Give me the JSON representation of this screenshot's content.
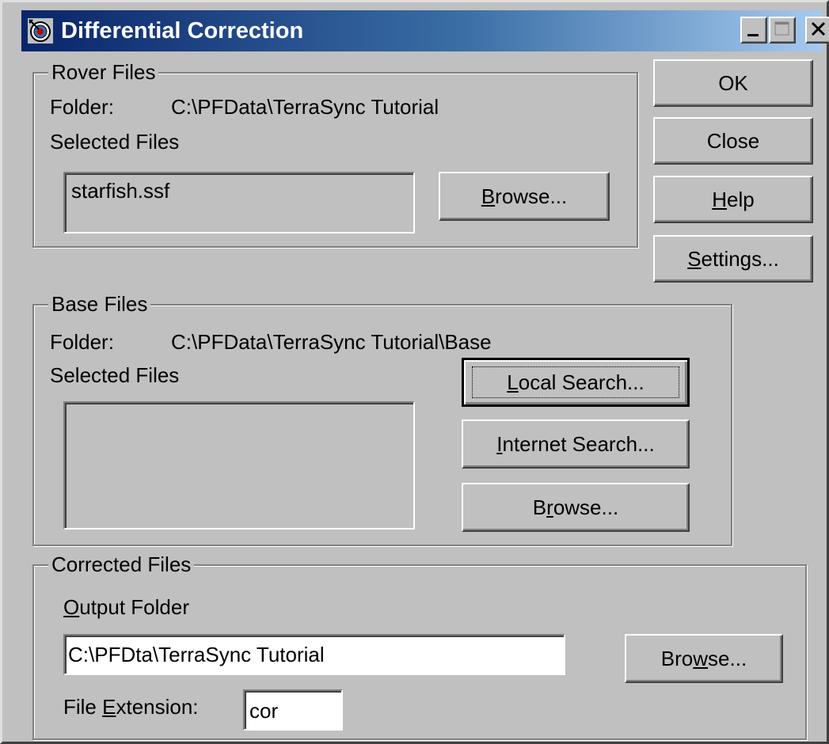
{
  "window": {
    "title": "Differential Correction"
  },
  "rover": {
    "legend": "Rover Files",
    "folder_label": "Folder:",
    "folder_value": "C:\\PFData\\TerraSync Tutorial",
    "selected_label": "Selected Files",
    "selected_items": [
      "starfish.ssf"
    ],
    "browse_pre": "",
    "browse_u": "B",
    "browse_post": "rowse..."
  },
  "side_buttons": {
    "ok": "OK",
    "close": "Close",
    "help_u": "H",
    "help_post": "elp",
    "settings_u": "S",
    "settings_post": "ettings..."
  },
  "base": {
    "legend": "Base Files",
    "folder_label": "Folder:",
    "folder_value": "C:\\PFData\\TerraSync Tutorial\\Base",
    "selected_label": "Selected Files",
    "local_u": "L",
    "local_post": "ocal Search...",
    "internet_u": "I",
    "internet_post": "nternet Search...",
    "browse_pre": "B",
    "browse_u": "r",
    "browse_post": "owse..."
  },
  "corrected": {
    "legend": "Corrected Files",
    "output_u": "O",
    "output_post": "utput Folder",
    "output_value": "C:\\PFDta\\TerraSync Tutorial",
    "browse_pre": "Bro",
    "browse_u": "w",
    "browse_post": "se...",
    "ext_pre": "File ",
    "ext_u": "E",
    "ext_post": "xtension:",
    "ext_value": "cor"
  }
}
